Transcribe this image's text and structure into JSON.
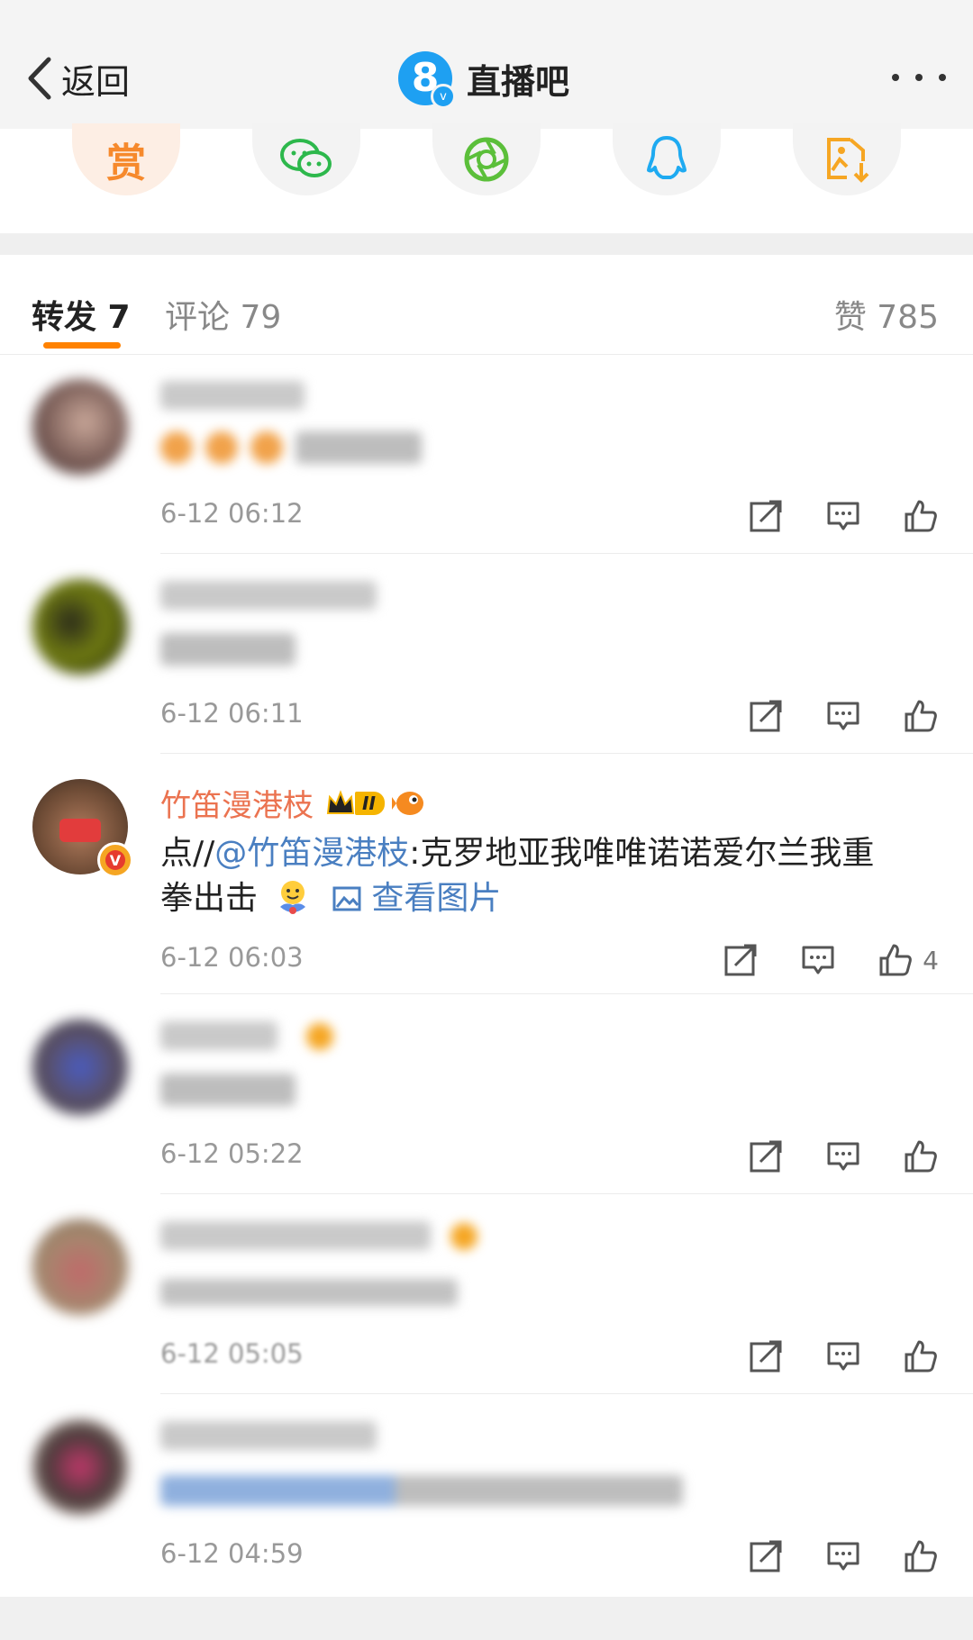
{
  "nav": {
    "back_label": "返回",
    "title": "直播吧",
    "logo_number": "8",
    "verified_mark": "v"
  },
  "share": {
    "reward_label": "赏",
    "icons": [
      "reward-icon",
      "wechat-icon",
      "moments-icon",
      "qq-icon",
      "save-image-icon"
    ]
  },
  "tabs": {
    "reposts": "转发 7",
    "comments": "评论 79",
    "likes": "赞 785"
  },
  "comments": [
    {
      "name": "",
      "text": "",
      "time": "6-12 06:12",
      "likes": ""
    },
    {
      "name": "",
      "text": "",
      "time": "6-12 06:11",
      "likes": ""
    },
    {
      "name": "竹笛漫港枝",
      "text_prefix": "点//",
      "mention": "@竹笛漫港枝",
      "text_body": ":克罗地亚我唯唯诺诺爱尔兰我重",
      "text_line2": "拳出击",
      "view_image": "查看图片",
      "time": "6-12 06:03",
      "likes": "4",
      "badge_level": "II",
      "verified_mark": "V"
    },
    {
      "name": "",
      "text": "",
      "time": "6-12 05:22",
      "likes": ""
    },
    {
      "name": "",
      "text": "",
      "time": "6-12 05:05",
      "likes": ""
    },
    {
      "name": "",
      "text": "",
      "time": "6-12 04:59",
      "likes": ""
    }
  ],
  "colors": {
    "accent": "#ff8200",
    "link": "#4a7fc1",
    "username": "#eb7350",
    "muted": "#999999"
  }
}
